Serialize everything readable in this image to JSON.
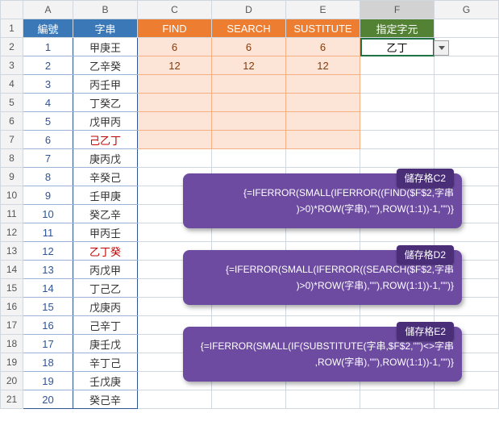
{
  "columns": [
    "A",
    "B",
    "C",
    "D",
    "E",
    "F",
    "G"
  ],
  "headers": {
    "A": "編號",
    "B": "字串",
    "C": "FIND",
    "D": "SEARCH",
    "E": "SUSTITUTE",
    "F": "指定字元"
  },
  "f2_value": "乙丁",
  "rows": [
    {
      "n": "1",
      "a": "1",
      "b": "甲庚王",
      "c": "6",
      "d": "6",
      "e": "6",
      "red": false
    },
    {
      "n": "2",
      "a": "2",
      "b": "乙辛癸",
      "c": "12",
      "d": "12",
      "e": "12",
      "red": false
    },
    {
      "n": "3",
      "a": "3",
      "b": "丙壬甲",
      "c": "",
      "d": "",
      "e": "",
      "red": false
    },
    {
      "n": "4",
      "a": "4",
      "b": "丁癸乙",
      "c": "",
      "d": "",
      "e": "",
      "red": false
    },
    {
      "n": "5",
      "a": "5",
      "b": "戊甲丙",
      "c": "",
      "d": "",
      "e": "",
      "red": false
    },
    {
      "n": "6",
      "a": "6",
      "b": "己乙丁",
      "c": "",
      "d": "",
      "e": "",
      "red": true
    },
    {
      "n": "7",
      "a": "7",
      "b": "庚丙戊",
      "c": "",
      "d": "",
      "e": "",
      "red": false
    },
    {
      "n": "8",
      "a": "8",
      "b": "辛癸己",
      "c": "",
      "d": "",
      "e": "",
      "red": false
    },
    {
      "n": "9",
      "a": "9",
      "b": "壬甲庚",
      "c": "",
      "d": "",
      "e": "",
      "red": false
    },
    {
      "n": "10",
      "a": "10",
      "b": "癸乙辛",
      "c": "",
      "d": "",
      "e": "",
      "red": false
    },
    {
      "n": "11",
      "a": "11",
      "b": "甲丙壬",
      "c": "",
      "d": "",
      "e": "",
      "red": false
    },
    {
      "n": "12",
      "a": "12",
      "b": "乙丁癸",
      "c": "",
      "d": "",
      "e": "",
      "red": true
    },
    {
      "n": "13",
      "a": "13",
      "b": "丙戊甲",
      "c": "",
      "d": "",
      "e": "",
      "red": false
    },
    {
      "n": "14",
      "a": "14",
      "b": "丁己乙",
      "c": "",
      "d": "",
      "e": "",
      "red": false
    },
    {
      "n": "15",
      "a": "15",
      "b": "戊庚丙",
      "c": "",
      "d": "",
      "e": "",
      "red": false
    },
    {
      "n": "16",
      "a": "16",
      "b": "己辛丁",
      "c": "",
      "d": "",
      "e": "",
      "red": false
    },
    {
      "n": "17",
      "a": "17",
      "b": "庚壬戊",
      "c": "",
      "d": "",
      "e": "",
      "red": false
    },
    {
      "n": "18",
      "a": "18",
      "b": "辛丁己",
      "c": "",
      "d": "",
      "e": "",
      "red": false
    },
    {
      "n": "19",
      "a": "19",
      "b": "壬戊庚",
      "c": "",
      "d": "",
      "e": "",
      "red": false
    },
    {
      "n": "20",
      "a": "20",
      "b": "癸己辛",
      "c": "",
      "d": "",
      "e": "",
      "red": false
    }
  ],
  "callouts": [
    {
      "label": "儲存格C2",
      "formula": "{=IFERROR(SMALL(IFERROR((FIND($F$2,字串\n)>0)*ROW(字串),\"\"),ROW(1:1))-1,\"\")}"
    },
    {
      "label": "儲存格D2",
      "formula": "{=IFERROR(SMALL(IFERROR((SEARCH($F$2,字串\n)>0)*ROW(字串),\"\"),ROW(1:1))-1,\"\")}"
    },
    {
      "label": "儲存格E2",
      "formula": "{=IFERROR(SMALL(IF(SUBSTITUTE(字串,$F$2,\"\")<>字串\n,ROW(字串),\"\"),ROW(1:1))-1,\"\")}"
    }
  ]
}
